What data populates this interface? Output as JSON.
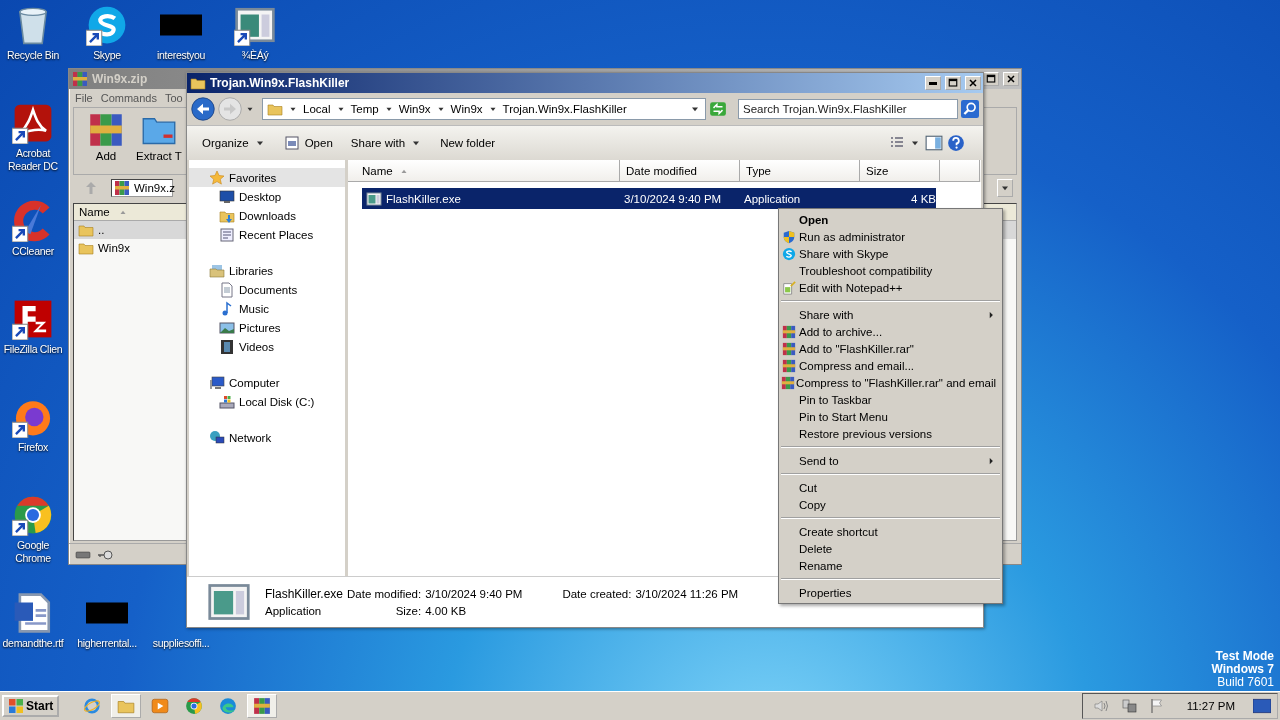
{
  "desktop_icons": [
    {
      "label": "Recycle Bin",
      "kind": "recycle",
      "shortcut": false
    },
    {
      "label": "Skype",
      "kind": "skype",
      "shortcut": true
    },
    {
      "label": "interestyou",
      "kind": "redacted",
      "shortcut": false
    },
    {
      "label": "¾ÈÁý",
      "kind": "appwindow",
      "shortcut": true
    },
    {
      "label": "Acrobat Reader DC",
      "kind": "acrobat",
      "shortcut": true
    },
    {
      "label": "CCleaner",
      "kind": "ccleaner",
      "shortcut": true
    },
    {
      "label": "FileZilla Clien",
      "kind": "filezilla",
      "shortcut": true
    },
    {
      "label": "Firefox",
      "kind": "firefox",
      "shortcut": true
    },
    {
      "label": "Google Chrome",
      "kind": "chrome",
      "shortcut": true
    },
    {
      "label": "demandthe.rtf",
      "kind": "word",
      "shortcut": false
    },
    {
      "label": "higherrental...",
      "kind": "redacted",
      "shortcut": false
    },
    {
      "label": "suppliesoffi...",
      "kind": "hidden"
    }
  ],
  "archive_window": {
    "title": "Win9x.zip",
    "active": false,
    "menu": [
      "File",
      "Commands",
      "Too"
    ],
    "tools": [
      {
        "label": "Add",
        "kind": "winrar"
      },
      {
        "label": "Extract T",
        "kind": "extract"
      }
    ],
    "path": "Win9x.z",
    "columns": [
      {
        "label": "Name",
        "sorted": true
      }
    ],
    "rows": [
      {
        "name": "..",
        "selected": true
      },
      {
        "name": "Win9x",
        "selected": false
      }
    ]
  },
  "explorer": {
    "title": "Trojan.Win9x.FlashKiller",
    "active": true,
    "breadcrumb": [
      "Local",
      "Temp",
      "Win9x",
      "Win9x",
      "Trojan.Win9x.FlashKiller"
    ],
    "search": {
      "placeholder": "Search Trojan.Win9x.FlashKiller"
    },
    "toolbar": [
      {
        "label": "Organize",
        "kind": "plain",
        "dropdown": true
      },
      {
        "label": "Open",
        "kind": "open",
        "dropdown": false
      },
      {
        "label": "Share with",
        "kind": "plain",
        "dropdown": true
      },
      {
        "label": "New folder",
        "kind": "plain",
        "dropdown": false
      }
    ],
    "nav": [
      {
        "label": "Favorites",
        "kind": "star",
        "selected": true,
        "children": [
          {
            "label": "Desktop",
            "kind": "monitor",
            "selected": false
          },
          {
            "label": "Downloads",
            "kind": "downloads",
            "selected": false
          },
          {
            "label": "Recent Places",
            "kind": "recent",
            "selected": false
          }
        ]
      },
      {
        "label": "Libraries",
        "kind": "libraries",
        "selected": false,
        "children": [
          {
            "label": "Documents",
            "kind": "documents",
            "selected": false
          },
          {
            "label": "Music",
            "kind": "music",
            "selected": false
          },
          {
            "label": "Pictures",
            "kind": "pictures",
            "selected": false
          },
          {
            "label": "Videos",
            "kind": "videos",
            "selected": false
          }
        ]
      },
      {
        "label": "Computer",
        "kind": "computer",
        "selected": false,
        "children": [
          {
            "label": "Local Disk (C:)",
            "kind": "disk",
            "selected": false
          }
        ]
      },
      {
        "label": "Network",
        "kind": "network",
        "selected": false
      }
    ],
    "columns": [
      {
        "label": "Name",
        "sorted": true
      },
      {
        "label": "Date modified",
        "sorted": false
      },
      {
        "label": "Type",
        "sorted": false
      },
      {
        "label": "Size",
        "sorted": false
      }
    ],
    "files": [
      {
        "name": "FlashKiller.exe",
        "date_modified": "3/10/2024 9:40 PM",
        "type": "Application",
        "size": "4 KB",
        "selected": true
      }
    ],
    "details": {
      "name": "FlashKiller.exe",
      "type": "Application",
      "fields": [
        {
          "label": "Date modified:",
          "value": "3/10/2024 9:40 PM"
        },
        {
          "label": "Date created:",
          "value": "3/10/2024 11:26 PM"
        },
        {
          "label": "Size:",
          "value": "4.00 KB"
        }
      ]
    }
  },
  "context_menu": {
    "groups": [
      [
        {
          "label": "Open",
          "kind": "plain",
          "bold": true,
          "submenu": false
        },
        {
          "label": "Run as administrator",
          "kind": "shield",
          "bold": false,
          "submenu": false
        },
        {
          "label": "Share with Skype",
          "kind": "skype",
          "bold": false,
          "submenu": false
        },
        {
          "label": "Troubleshoot compatibility",
          "kind": "plain",
          "bold": false,
          "submenu": false
        },
        {
          "label": "Edit with Notepad++",
          "kind": "notepad",
          "bold": false,
          "submenu": false
        }
      ],
      [
        {
          "label": "Share with",
          "kind": "plain",
          "bold": false,
          "submenu": true
        },
        {
          "label": "Add to archive...",
          "kind": "winrar",
          "bold": false,
          "submenu": false
        },
        {
          "label": "Add to \"FlashKiller.rar\"",
          "kind": "winrar",
          "bold": false,
          "submenu": false
        },
        {
          "label": "Compress and email...",
          "kind": "winrar",
          "bold": false,
          "submenu": false
        },
        {
          "label": "Compress to \"FlashKiller.rar\" and email",
          "kind": "winrar",
          "bold": false,
          "submenu": false
        },
        {
          "label": "Pin to Taskbar",
          "kind": "plain",
          "bold": false,
          "submenu": false
        },
        {
          "label": "Pin to Start Menu",
          "kind": "plain",
          "bold": false,
          "submenu": false
        },
        {
          "label": "Restore previous versions",
          "kind": "plain",
          "bold": false,
          "submenu": false
        }
      ],
      [
        {
          "label": "Send to",
          "kind": "plain",
          "bold": false,
          "submenu": true
        }
      ],
      [
        {
          "label": "Cut",
          "kind": "plain",
          "bold": false,
          "submenu": false
        },
        {
          "label": "Copy",
          "kind": "plain",
          "bold": false,
          "submenu": false
        }
      ],
      [
        {
          "label": "Create shortcut",
          "kind": "plain",
          "bold": false,
          "submenu": false
        },
        {
          "label": "Delete",
          "kind": "plain",
          "bold": false,
          "submenu": false
        },
        {
          "label": "Rename",
          "kind": "plain",
          "bold": false,
          "submenu": false
        }
      ],
      [
        {
          "label": "Properties",
          "kind": "plain",
          "bold": false,
          "submenu": false
        }
      ]
    ]
  },
  "system_watermark": [
    {
      "text": "Test Mode",
      "bold": true
    },
    {
      "text": "Windows 7",
      "bold": true
    },
    {
      "text": "Build 7601",
      "bold": false
    }
  ],
  "taskbar": {
    "start": "Start",
    "apps": [
      {
        "kind": "ie",
        "active": false
      },
      {
        "kind": "folder",
        "active": true
      },
      {
        "kind": "media",
        "active": false
      },
      {
        "kind": "chrome",
        "active": false
      },
      {
        "kind": "edge",
        "active": false
      },
      {
        "kind": "winrar",
        "active": true
      }
    ],
    "clock": "11:27 PM"
  }
}
